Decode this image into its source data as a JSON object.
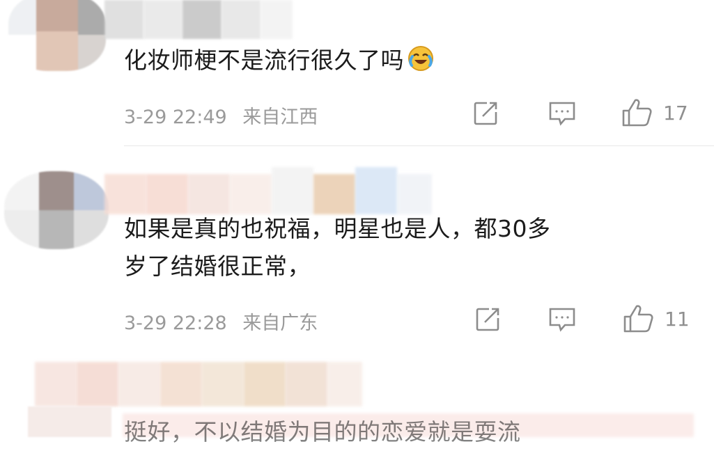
{
  "comments": [
    {
      "text_lines": [
        "化妆师梗不是流行很久了吗"
      ],
      "emoji": "laughing-crying-emoji",
      "time": "3-29 22:49",
      "location": "来自江西",
      "likes": "17"
    },
    {
      "text_lines": [
        "如果是真的也祝福，明星也是人，都30多",
        "岁了结婚很正常，"
      ],
      "time": "3-29 22:28",
      "location": "来自广东",
      "likes": "11"
    },
    {
      "text_lines": [
        "挺好，不以结婚为目的的恋爱就是耍流"
      ]
    }
  ],
  "icons": {
    "share": "share-icon",
    "reply": "comment-icon",
    "like": "thumbs-up-icon"
  },
  "colors": {
    "meta_text": "#9a9a9a",
    "divider": "#e8e8e8",
    "icon_stroke": "#8c8c8c"
  }
}
